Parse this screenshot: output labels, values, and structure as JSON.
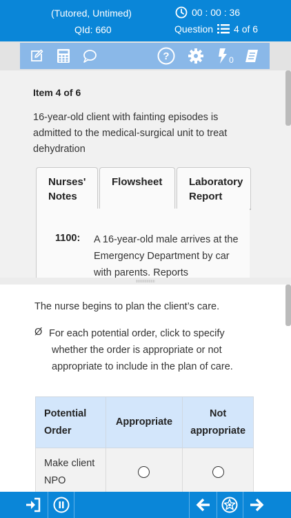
{
  "header": {
    "mode": "(Tutored, Untimed)",
    "qid": "QId: 660",
    "timer": "00 : 00 : 36",
    "question_label": "Question",
    "question_count": "4 of 6"
  },
  "toolbar": {
    "icons": [
      "edit-icon",
      "calculator-icon",
      "comment-icon",
      "help-icon",
      "gear-icon",
      "lab-values-icon",
      "notes-icon"
    ],
    "lab_subscript": "0"
  },
  "item": {
    "title": "Item 4 of 6",
    "stem": "16-year-old client with fainting episodes is admitted to the medical-surgical unit to treat dehydration"
  },
  "tabs": {
    "nurses_notes_l1": "Nurses'",
    "nurses_notes_l2": "Notes",
    "flowsheet": "Flowsheet",
    "lab_l1": "Laboratory",
    "lab_l2": "Report"
  },
  "notes": {
    "time": "1100:",
    "text": "A 16-year-old male arrives at the Emergency Department by car with parents. Reports"
  },
  "question": {
    "lead": "The nurse begins to plan the client’s care.",
    "instruction_symbol": "Ø",
    "instruction": "For each potential order, click to specify whether the order is appropriate or not appropriate to include in the plan of care."
  },
  "table": {
    "headers": [
      "Potential Order",
      "Appropriate",
      "Not appropriate"
    ],
    "rows": [
      {
        "order": "Make client NPO",
        "appropriate": false,
        "not_appropriate": false
      }
    ]
  },
  "footer": {
    "icons": [
      "exit-icon",
      "pause-icon",
      "previous-icon",
      "navigator-icon",
      "next-icon"
    ]
  },
  "colors": {
    "header_blue": "#0a86d8",
    "toolbar_blue": "#8ab8e8",
    "table_header": "#d3e6fb"
  }
}
